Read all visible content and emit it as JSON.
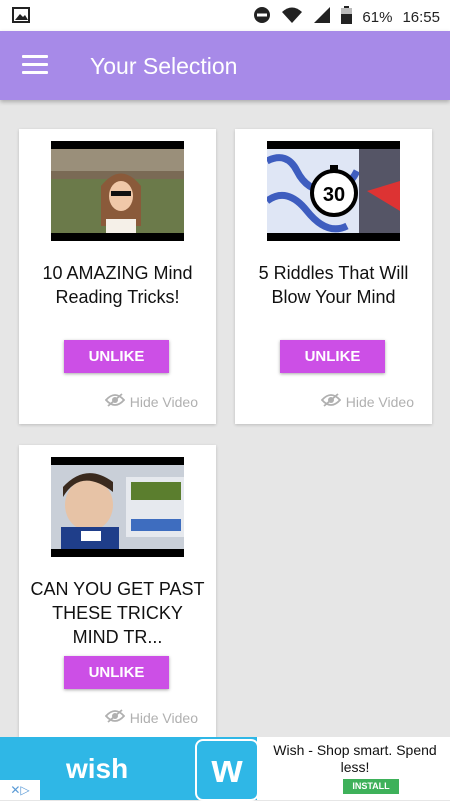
{
  "status_bar": {
    "battery": "61%",
    "time": "16:55"
  },
  "app_bar": {
    "title": "Your Selection"
  },
  "colors": {
    "accent": "#a78ae8",
    "button": "#cc4fe6",
    "ad_bg": "#2fb7e6",
    "install": "#3eb15a"
  },
  "cards": [
    {
      "title": "10 AMAZING Mind Reading Tricks!",
      "button": "UNLIKE",
      "hide": "Hide Video"
    },
    {
      "title": "5 Riddles That Will Blow Your Mind",
      "button": "UNLIKE",
      "hide": "Hide Video",
      "thumb_number": "30"
    },
    {
      "title": "CAN YOU GET PAST THESE TRICKY MIND TR...",
      "button": "UNLIKE",
      "hide": "Hide Video"
    }
  ],
  "ad": {
    "brand": "wish",
    "icon_letter": "w",
    "text": "Wish - Shop smart. Spend less!",
    "install": "INSTALL"
  }
}
